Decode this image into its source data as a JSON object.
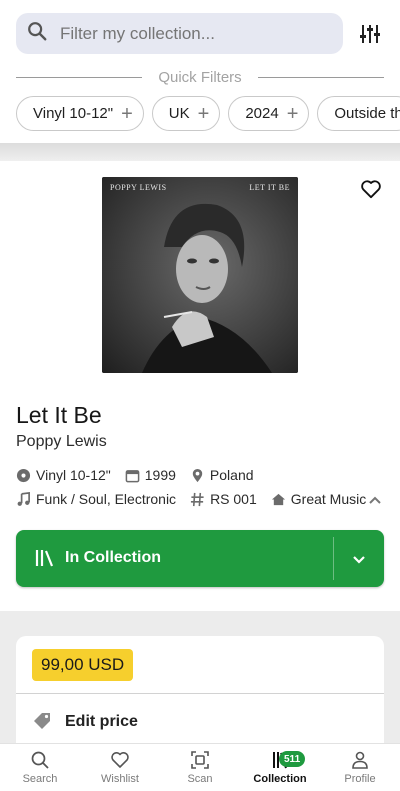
{
  "search": {
    "placeholder": "Filter my collection..."
  },
  "quick_filters": {
    "title": "Quick Filters",
    "chips": [
      "Vinyl 10-12\"",
      "UK",
      "2024",
      "Outside th"
    ]
  },
  "release": {
    "cover_artist": "POPPY LEWIS",
    "cover_title": "LET IT BE",
    "title": "Let It Be",
    "artist": "Poppy Lewis",
    "format": "Vinyl 10-12\"",
    "year": "1999",
    "country": "Poland",
    "genres": "Funk / Soul, Electronic",
    "catalog": "RS 001",
    "label": "Great Music",
    "collection_button": "In Collection"
  },
  "price": {
    "value": "99,00 USD",
    "edit_label": "Edit price"
  },
  "nav": {
    "items": [
      {
        "label": "Search",
        "icon": "search-icon"
      },
      {
        "label": "Wishlist",
        "icon": "heart-icon"
      },
      {
        "label": "Scan",
        "icon": "scan-icon"
      },
      {
        "label": "Collection",
        "icon": "library-icon"
      },
      {
        "label": "Profile",
        "icon": "profile-icon"
      }
    ],
    "collection_badge": "511",
    "active": "Collection"
  },
  "colors": {
    "accent_green": "#1f9a3f",
    "price_yellow": "#f6cf2d",
    "search_bg": "#e6e8f2"
  }
}
